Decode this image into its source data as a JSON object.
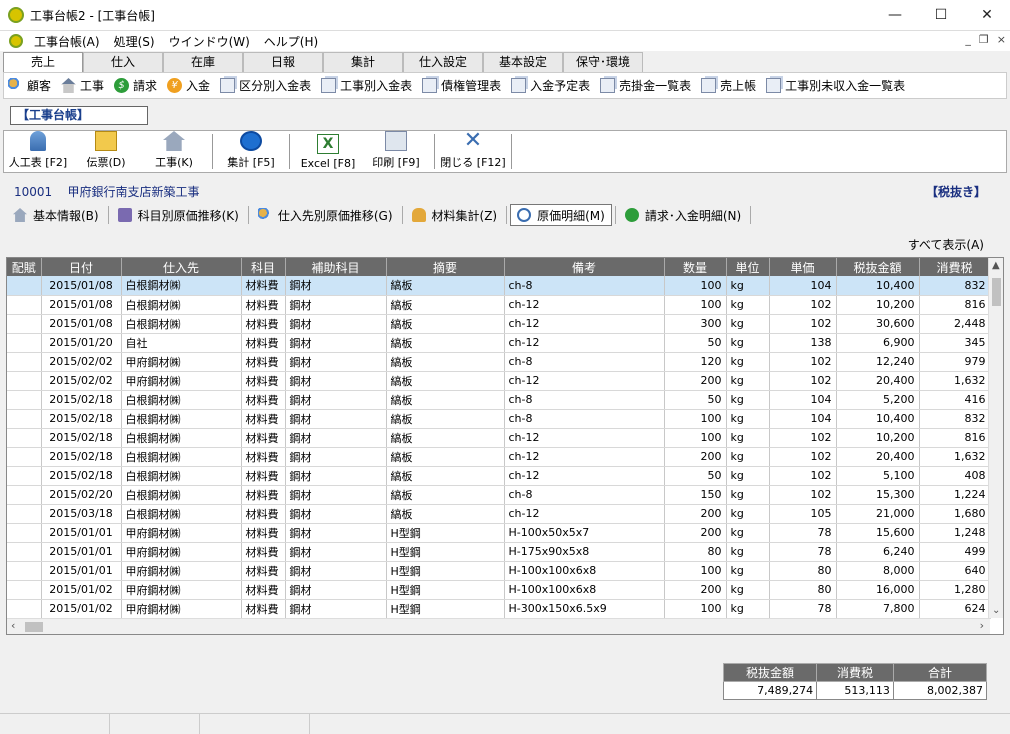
{
  "window": {
    "title": "工事台帳2 - [工事台帳]",
    "min": "—",
    "max": "☐",
    "close": "✕"
  },
  "menu": {
    "items": [
      "工事台帳(A)",
      "処理(S)",
      "ウインドウ(W)",
      "ヘルプ(H)"
    ],
    "mdi_min": "_",
    "mdi_restore": "❐",
    "mdi_close": "×"
  },
  "tabs": [
    "売上",
    "仕入",
    "在庫",
    "日報",
    "集計",
    "仕入設定",
    "基本設定",
    "保守･環境"
  ],
  "quicktools": [
    "顧客",
    "工事",
    "請求",
    "入金",
    "区分別入金表",
    "工事別入金表",
    "債権管理表",
    "入金予定表",
    "売掛金一覧表",
    "売上帳",
    "工事別未収入金一覧表"
  ],
  "page_title": "【工事台帳】",
  "toolbar": {
    "labor": "人工表 [F2]",
    "slip": "伝票(D)",
    "construction": "工事(K)",
    "summary": "集計 [F5]",
    "excel": "Excel [F8]",
    "print": "印刷 [F9]",
    "close": "閉じる [F12]"
  },
  "project": {
    "code": "10001",
    "name": "甲府銀行南支店新築工事",
    "tax_note": "【税抜き】"
  },
  "subtabs": [
    "基本情報(B)",
    "科目別原価推移(K)",
    "仕入先別原価推移(G)",
    "材料集計(Z)",
    "原価明細(M)",
    "請求･入金明細(N)"
  ],
  "show_all": "すべて表示(A)",
  "grid": {
    "columns": [
      "配賦",
      "日付",
      "仕入先",
      "科目",
      "補助科目",
      "摘要",
      "備考",
      "数量",
      "単位",
      "単価",
      "税抜金額",
      "消費税"
    ],
    "rows": [
      [
        "",
        "2015/01/08",
        "白根鋼材㈱",
        "材料費",
        "鋼材",
        "縞板",
        "ch-8",
        "100",
        "kg",
        "104",
        "10,400",
        "832"
      ],
      [
        "",
        "2015/01/08",
        "白根鋼材㈱",
        "材料費",
        "鋼材",
        "縞板",
        "ch-12",
        "100",
        "kg",
        "102",
        "10,200",
        "816"
      ],
      [
        "",
        "2015/01/08",
        "白根鋼材㈱",
        "材料費",
        "鋼材",
        "縞板",
        "ch-12",
        "300",
        "kg",
        "102",
        "30,600",
        "2,448"
      ],
      [
        "",
        "2015/01/20",
        "自社",
        "材料費",
        "鋼材",
        "縞板",
        "ch-12",
        "50",
        "kg",
        "138",
        "6,900",
        "345"
      ],
      [
        "",
        "2015/02/02",
        "甲府鋼材㈱",
        "材料費",
        "鋼材",
        "縞板",
        "ch-8",
        "120",
        "kg",
        "102",
        "12,240",
        "979"
      ],
      [
        "",
        "2015/02/02",
        "甲府鋼材㈱",
        "材料費",
        "鋼材",
        "縞板",
        "ch-12",
        "200",
        "kg",
        "102",
        "20,400",
        "1,632"
      ],
      [
        "",
        "2015/02/18",
        "白根鋼材㈱",
        "材料費",
        "鋼材",
        "縞板",
        "ch-8",
        "50",
        "kg",
        "104",
        "5,200",
        "416"
      ],
      [
        "",
        "2015/02/18",
        "白根鋼材㈱",
        "材料費",
        "鋼材",
        "縞板",
        "ch-8",
        "100",
        "kg",
        "104",
        "10,400",
        "832"
      ],
      [
        "",
        "2015/02/18",
        "白根鋼材㈱",
        "材料費",
        "鋼材",
        "縞板",
        "ch-12",
        "100",
        "kg",
        "102",
        "10,200",
        "816"
      ],
      [
        "",
        "2015/02/18",
        "白根鋼材㈱",
        "材料費",
        "鋼材",
        "縞板",
        "ch-12",
        "200",
        "kg",
        "102",
        "20,400",
        "1,632"
      ],
      [
        "",
        "2015/02/18",
        "白根鋼材㈱",
        "材料費",
        "鋼材",
        "縞板",
        "ch-12",
        "50",
        "kg",
        "102",
        "5,100",
        "408"
      ],
      [
        "",
        "2015/02/20",
        "白根鋼材㈱",
        "材料費",
        "鋼材",
        "縞板",
        "ch-8",
        "150",
        "kg",
        "102",
        "15,300",
        "1,224"
      ],
      [
        "",
        "2015/03/18",
        "白根鋼材㈱",
        "材料費",
        "鋼材",
        "縞板",
        "ch-12",
        "200",
        "kg",
        "105",
        "21,000",
        "1,680"
      ],
      [
        "",
        "2015/01/01",
        "甲府鋼材㈱",
        "材料費",
        "鋼材",
        "H型鋼",
        "H-100x50x5x7",
        "200",
        "kg",
        "78",
        "15,600",
        "1,248"
      ],
      [
        "",
        "2015/01/01",
        "甲府鋼材㈱",
        "材料費",
        "鋼材",
        "H型鋼",
        "H-175x90x5x8",
        "80",
        "kg",
        "78",
        "6,240",
        "499"
      ],
      [
        "",
        "2015/01/01",
        "甲府鋼材㈱",
        "材料費",
        "鋼材",
        "H型鋼",
        "H-100x100x6x8",
        "100",
        "kg",
        "80",
        "8,000",
        "640"
      ],
      [
        "",
        "2015/01/02",
        "甲府鋼材㈱",
        "材料費",
        "鋼材",
        "H型鋼",
        "H-100x100x6x8",
        "200",
        "kg",
        "80",
        "16,000",
        "1,280"
      ],
      [
        "",
        "2015/01/02",
        "甲府鋼材㈱",
        "材料費",
        "鋼材",
        "H型鋼",
        "H-300x150x6.5x9",
        "100",
        "kg",
        "78",
        "7,800",
        "624"
      ]
    ]
  },
  "totals": {
    "headers": [
      "税抜金額",
      "消費税",
      "合計"
    ],
    "values": [
      "7,489,274",
      "513,113",
      "8,002,387"
    ]
  },
  "colors": {
    "header_bg": "#6a6a6a",
    "selected_row": "#cce4f7",
    "accent_text": "#1a2f80"
  }
}
